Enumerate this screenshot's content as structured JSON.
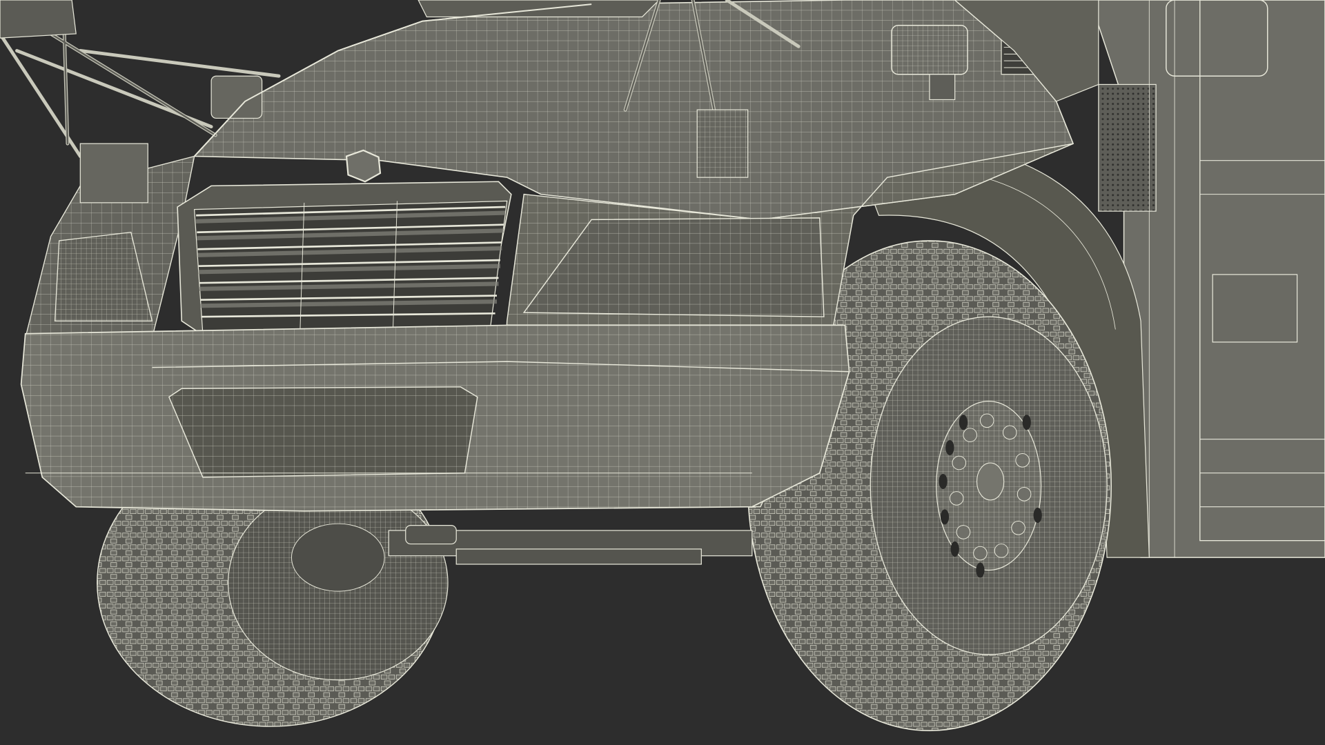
{
  "scene": {
    "subject": "school-bus-front-wireframe",
    "render_mode": "wireframe-shaded",
    "colors": {
      "background": "#2d2d2d",
      "surface": "#6d6d66",
      "surface_dark": "#4f4f4a",
      "surface_light": "#85857d",
      "wire": "#e8e8da",
      "tire": "#5b5b55",
      "shadow": "#3a3a37"
    }
  }
}
